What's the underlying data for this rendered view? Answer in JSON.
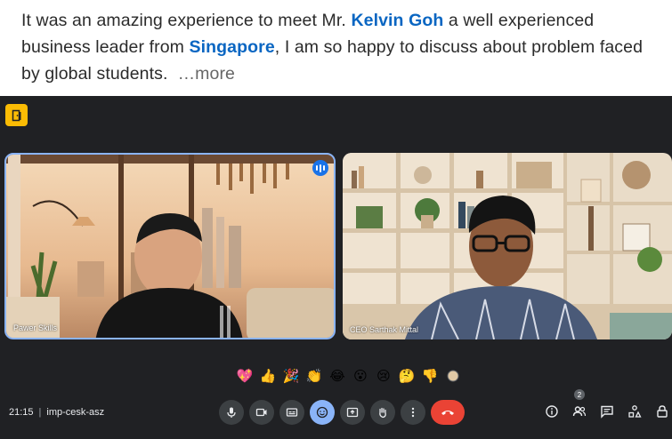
{
  "post": {
    "text_1": "It was an amazing experience to meet Mr. ",
    "mention_person": "Kelvin Goh",
    "text_2": " a well experienced business leader from ",
    "mention_place": "Singapore",
    "text_3": ", I am so happy to discuss about problem faced by global students.",
    "more_label": "…more"
  },
  "meeting": {
    "participants": [
      {
        "name": "Pawer Skills"
      },
      {
        "name": "CEO Sarthak Mittal"
      }
    ],
    "reactions": [
      "💖",
      "👍",
      "🎉",
      "👏",
      "😂",
      "😮",
      "😢",
      "🤔",
      "👎"
    ],
    "time": "21:15",
    "meeting_code": "imp-cesk-asz",
    "participant_count": "2",
    "controls": [
      "microphone-icon",
      "camera-icon",
      "captions-icon",
      "emoji-icon",
      "present-icon",
      "raise-hand-icon",
      "more-options-icon",
      "end-call-icon"
    ],
    "right_controls": [
      "info-icon",
      "people-icon",
      "chat-icon",
      "activities-icon",
      "host-controls-icon"
    ],
    "colors": {
      "accent": "#8ab4f8",
      "end_call": "#ea4335",
      "background": "#202124",
      "mention": "#0a66c2"
    }
  }
}
